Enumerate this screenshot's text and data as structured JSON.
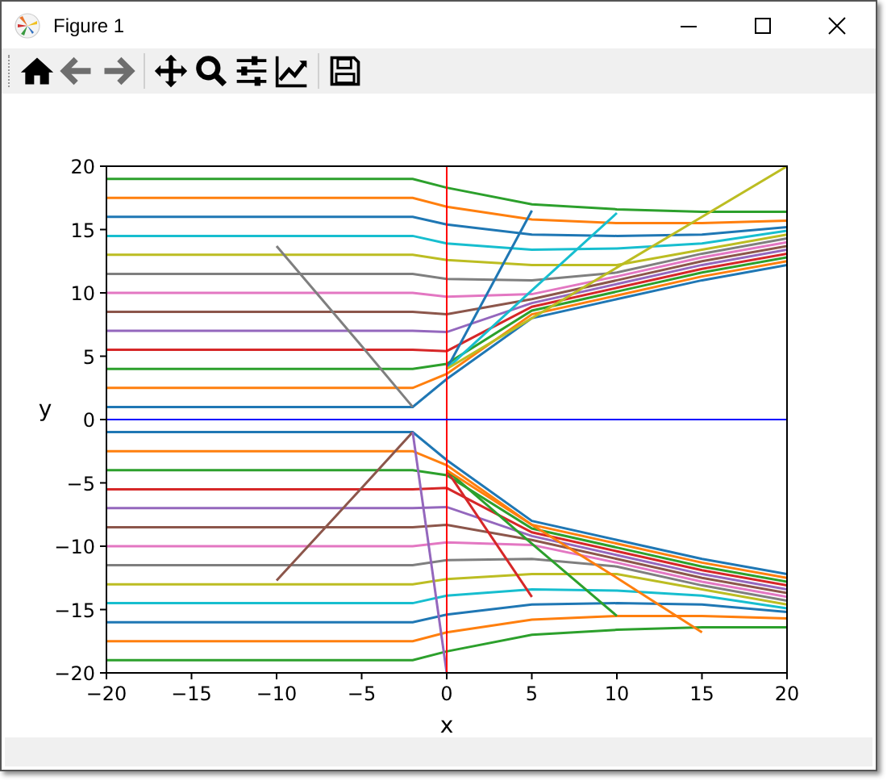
{
  "window": {
    "title": "Figure 1"
  },
  "toolbar": [
    {
      "kind": "home",
      "disabled": false
    },
    {
      "kind": "back",
      "disabled": true
    },
    {
      "kind": "forward",
      "disabled": true
    },
    {
      "kind": "pan",
      "disabled": false
    },
    {
      "kind": "zoom",
      "disabled": false
    },
    {
      "kind": "subplots",
      "disabled": false
    },
    {
      "kind": "axes",
      "disabled": false
    },
    {
      "kind": "save",
      "disabled": false
    }
  ],
  "figure": {
    "chart_data": {
      "type": "line",
      "xlabel": "x",
      "ylabel": "y",
      "xlim": [
        -20,
        20
      ],
      "ylim": [
        -20,
        20
      ],
      "xticks": [
        {
          "value": -20,
          "label": "−20"
        },
        {
          "value": -15,
          "label": "−15"
        },
        {
          "value": -10,
          "label": "−10"
        },
        {
          "value": -5,
          "label": "−5"
        },
        0,
        5,
        10,
        15,
        20
      ],
      "yticks": [
        {
          "value": -20,
          "label": "−20"
        },
        {
          "value": -15,
          "label": "−15"
        },
        {
          "value": -10,
          "label": "−10"
        },
        {
          "value": -5,
          "label": "−5"
        },
        0,
        5,
        10,
        15,
        20
      ],
      "x": [
        -20,
        -10,
        -5,
        -2,
        0,
        5,
        10,
        15,
        20
      ],
      "series": [
        {
          "color": "#1f77b4",
          "values": [
            1,
            1,
            1,
            1,
            3.2,
            8,
            9.5,
            11,
            12.2
          ]
        },
        {
          "color": "#ff7f0e",
          "values": [
            2.5,
            2.5,
            2.5,
            2.5,
            3.6,
            8.3,
            9.8,
            11.3,
            12.5
          ]
        },
        {
          "color": "#2ca02c",
          "values": [
            4,
            4,
            4,
            4,
            4.4,
            8.6,
            10.1,
            11.6,
            12.8
          ]
        },
        {
          "color": "#d62728",
          "values": [
            5.5,
            5.5,
            5.5,
            5.5,
            5.4,
            8.9,
            10.4,
            11.9,
            13.1
          ]
        },
        {
          "color": "#9467bd",
          "values": [
            7,
            7,
            7,
            7,
            6.9,
            9.2,
            10.7,
            12.2,
            13.4
          ]
        },
        {
          "color": "#8c564b",
          "values": [
            8.5,
            8.5,
            8.5,
            8.5,
            8.3,
            9.5,
            11,
            12.5,
            13.7
          ]
        },
        {
          "color": "#e377c2",
          "values": [
            10,
            10,
            10,
            10,
            9.7,
            9.9,
            11.3,
            12.8,
            14
          ]
        },
        {
          "color": "#7f7f7f",
          "values": [
            11.5,
            11.5,
            11.5,
            11.5,
            11.1,
            11,
            11.6,
            13.1,
            14.3
          ]
        },
        {
          "color": "#bcbd22",
          "values": [
            13,
            13,
            13,
            13,
            12.6,
            12.2,
            12.2,
            13.4,
            14.6
          ]
        },
        {
          "color": "#17becf",
          "values": [
            14.5,
            14.5,
            14.5,
            14.5,
            13.9,
            13.4,
            13.5,
            13.9,
            14.9
          ]
        },
        {
          "color": "#1f77b4",
          "values": [
            16,
            16,
            16,
            16,
            15.4,
            14.6,
            14.5,
            14.6,
            15.2
          ]
        },
        {
          "color": "#ff7f0e",
          "values": [
            17.5,
            17.5,
            17.5,
            17.5,
            16.8,
            15.8,
            15.5,
            15.5,
            15.7
          ]
        },
        {
          "color": "#2ca02c",
          "values": [
            19,
            19,
            19,
            19,
            18.3,
            17,
            16.6,
            16.4,
            16.4
          ]
        },
        {
          "color": "#1f77b4",
          "values": [
            -1,
            -1,
            -1,
            -1,
            -3.2,
            -8,
            -9.5,
            -11,
            -12.2
          ]
        },
        {
          "color": "#ff7f0e",
          "values": [
            -2.5,
            -2.5,
            -2.5,
            -2.5,
            -3.6,
            -8.3,
            -9.8,
            -11.3,
            -12.5
          ]
        },
        {
          "color": "#2ca02c",
          "values": [
            -4,
            -4,
            -4,
            -4,
            -4.4,
            -8.6,
            -10.1,
            -11.6,
            -12.8
          ]
        },
        {
          "color": "#d62728",
          "values": [
            -5.5,
            -5.5,
            -5.5,
            -5.5,
            -5.4,
            -8.9,
            -10.4,
            -11.9,
            -13.1
          ]
        },
        {
          "color": "#9467bd",
          "values": [
            -7,
            -7,
            -7,
            -7,
            -6.9,
            -9.2,
            -10.7,
            -12.2,
            -13.4
          ]
        },
        {
          "color": "#8c564b",
          "values": [
            -8.5,
            -8.5,
            -8.5,
            -8.5,
            -8.3,
            -9.5,
            -11,
            -12.5,
            -13.7
          ]
        },
        {
          "color": "#e377c2",
          "values": [
            -10,
            -10,
            -10,
            -10,
            -9.7,
            -9.9,
            -11.3,
            -12.8,
            -14
          ]
        },
        {
          "color": "#7f7f7f",
          "values": [
            -11.5,
            -11.5,
            -11.5,
            -11.5,
            -11.1,
            -11,
            -11.6,
            -13.1,
            -14.3
          ]
        },
        {
          "color": "#bcbd22",
          "values": [
            -13,
            -13,
            -13,
            -13,
            -12.6,
            -12.2,
            -12.2,
            -13.4,
            -14.6
          ]
        },
        {
          "color": "#17becf",
          "values": [
            -14.5,
            -14.5,
            -14.5,
            -14.5,
            -13.9,
            -13.4,
            -13.5,
            -13.9,
            -14.9
          ]
        },
        {
          "color": "#1f77b4",
          "values": [
            -16,
            -16,
            -16,
            -16,
            -15.4,
            -14.6,
            -14.5,
            -14.6,
            -15.2
          ]
        },
        {
          "color": "#ff7f0e",
          "values": [
            -17.5,
            -17.5,
            -17.5,
            -17.5,
            -16.8,
            -15.8,
            -15.5,
            -15.5,
            -15.7
          ]
        },
        {
          "color": "#2ca02c",
          "values": [
            -19,
            -19,
            -19,
            -19,
            -18.3,
            -17,
            -16.6,
            -16.4,
            -16.4
          ]
        },
        {
          "color": "#1f77b4",
          "values": [
            null,
            null,
            null,
            null,
            4,
            16.5,
            null,
            null,
            null
          ]
        },
        {
          "color": "#17becf",
          "values": [
            null,
            null,
            null,
            null,
            4,
            10.2,
            16.3,
            null,
            null
          ]
        },
        {
          "color": "#bcbd22",
          "values": [
            null,
            null,
            null,
            null,
            4,
            8,
            12,
            16,
            20
          ]
        },
        {
          "color": "#7f7f7f",
          "values": [
            null,
            13.7,
            5.8,
            1,
            null,
            null,
            null,
            null,
            null
          ]
        },
        {
          "color": "#d62728",
          "values": [
            null,
            null,
            null,
            null,
            -4,
            -14,
            null,
            null,
            null
          ]
        },
        {
          "color": "#2ca02c",
          "values": [
            null,
            null,
            null,
            null,
            -4,
            -9.8,
            -15.5,
            null,
            null
          ]
        },
        {
          "color": "#ff7f0e",
          "values": [
            null,
            null,
            null,
            null,
            -4,
            -8.3,
            -12.5,
            -16.8,
            null
          ]
        },
        {
          "color": "#8c564b",
          "values": [
            null,
            -12.7,
            -5.4,
            -1,
            null,
            null,
            null,
            null,
            null
          ]
        },
        {
          "color": "#9467bd",
          "values": [
            null,
            null,
            null,
            -1,
            -20,
            null,
            null,
            null,
            null
          ]
        }
      ],
      "ref_lines": [
        {
          "axis": "x",
          "value": 0,
          "color": "#ff0000"
        },
        {
          "axis": "y",
          "value": 0,
          "color": "#0000ff"
        }
      ]
    }
  }
}
